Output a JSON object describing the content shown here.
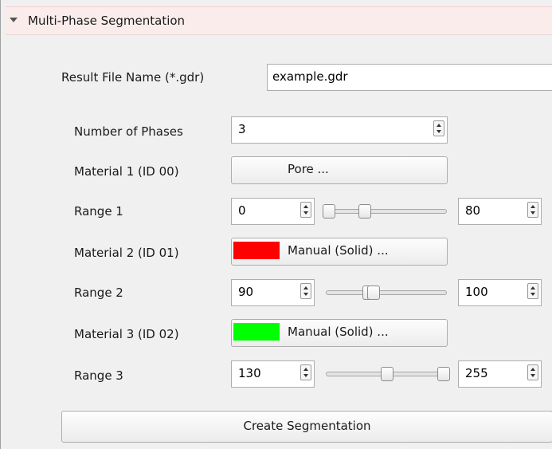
{
  "section": {
    "title": "Multi-Phase Segmentation"
  },
  "result_file": {
    "label": "Result File Name (*.gdr)",
    "value": "example.gdr"
  },
  "phases": {
    "label": "Number of Phases",
    "value": "3"
  },
  "materials": [
    {
      "label": "Material 1 (ID 00)",
      "button": "Pore ...",
      "color": null
    },
    {
      "label": "Material 2 (ID 01)",
      "button": "Manual (Solid) ...",
      "color": "#ff0000"
    },
    {
      "label": "Material 3 (ID 02)",
      "button": "Manual (Solid) ...",
      "color": "#00ff00"
    }
  ],
  "ranges": [
    {
      "label": "Range 1",
      "min": "0",
      "max": "80",
      "low_fraction": 0.0,
      "high_fraction": 0.31
    },
    {
      "label": "Range 2",
      "min": "90",
      "max": "100",
      "low_fraction": 0.35,
      "high_fraction": 0.39
    },
    {
      "label": "Range 3",
      "min": "130",
      "max": "255",
      "low_fraction": 0.51,
      "high_fraction": 1.0
    }
  ],
  "create_button": "Create Segmentation"
}
